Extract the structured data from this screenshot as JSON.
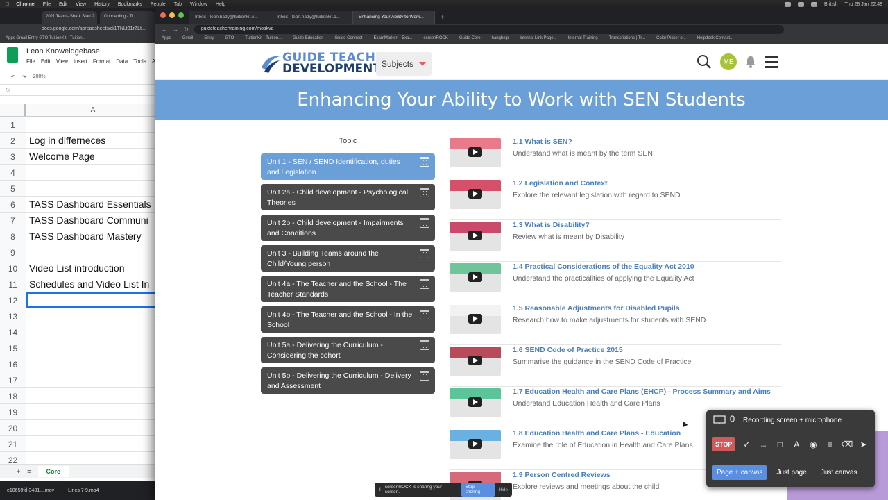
{
  "menubar": {
    "app": "Chrome",
    "items": [
      "File",
      "Edit",
      "View",
      "History",
      "Bookmarks",
      "People",
      "Tab",
      "Window",
      "Help"
    ],
    "input_source": "British",
    "clock": "Thu 28 Jan  22:48"
  },
  "sheets_window": {
    "tabs": [
      "2021 Team - Shark Start 2...",
      "Onboarding - Ti..."
    ],
    "url": "docs.google.com/spreadsheets/d/1TNLt31rZLt...",
    "bookmarks": "Apps   Gmail   Entry   GTO   TuitionKit - Tuition...",
    "title": "Leon Knoweldgebase",
    "menu": [
      "File",
      "Edit",
      "View",
      "Insert",
      "Format",
      "Data",
      "Tools",
      "A"
    ],
    "zoom": "200%",
    "fx": "fx",
    "column": "A",
    "rows": [
      {
        "n": "1",
        "v": ""
      },
      {
        "n": "2",
        "v": "Log in differneces"
      },
      {
        "n": "3",
        "v": "Welcome Page"
      },
      {
        "n": "4",
        "v": ""
      },
      {
        "n": "5",
        "v": ""
      },
      {
        "n": "6",
        "v": "TASS Dashboard Essentials"
      },
      {
        "n": "7",
        "v": "TASS Dashboard Communi"
      },
      {
        "n": "8",
        "v": "TASS Dashboard Mastery"
      },
      {
        "n": "9",
        "v": ""
      },
      {
        "n": "10",
        "v": "Video List introduction"
      },
      {
        "n": "11",
        "v": "Schedules and Video List In"
      },
      {
        "n": "12",
        "v": ""
      },
      {
        "n": "13",
        "v": ""
      },
      {
        "n": "14",
        "v": ""
      },
      {
        "n": "15",
        "v": ""
      },
      {
        "n": "16",
        "v": ""
      },
      {
        "n": "17",
        "v": ""
      },
      {
        "n": "18",
        "v": ""
      },
      {
        "n": "19",
        "v": ""
      },
      {
        "n": "20",
        "v": ""
      },
      {
        "n": "21",
        "v": ""
      },
      {
        "n": "22",
        "v": ""
      }
    ],
    "selected_row": "12",
    "sheet_tab": "Core",
    "downloads": [
      "e10659fd-3481....mov",
      "Lines 7-9.mp4"
    ]
  },
  "browser": {
    "tabs": [
      {
        "label": "Inbox - leon.hady@tuitionkit.c...",
        "active": false
      },
      {
        "label": "Inbox - leon.hady@tuitionkit.c...",
        "active": false
      },
      {
        "label": "Enhancing Your Ability to Work...",
        "active": true
      }
    ],
    "url": "guideteachertraining.com/moskva",
    "bookmarks": [
      "Apps",
      "Gmail",
      "Entry",
      "GTO",
      "TuitionKit - Tuition...",
      "Guide Education",
      "Guide Connect",
      "ExamMarker – Exa...",
      "screenROCK",
      "Guide Core",
      "hanghelp",
      "Internal Link Page...",
      "Internal Training",
      "Transcriptions | Tr...",
      "Color Picker o...",
      "Helpdesk Contact..."
    ]
  },
  "site": {
    "logo_line1": "GUIDE TEACHER",
    "logo_line2": "DEVELOPMENT",
    "subjects_label": "Subjects",
    "avatar_initials": "ME",
    "banner_title": "Enhancing Your Ability to Work with SEN Students",
    "topic_heading": "Topic",
    "units": [
      {
        "label": "Unit 1 - SEN / SEND Identification, duties and Legislation",
        "active": true
      },
      {
        "label": "Unit 2a - Child development - Psychological Theories",
        "active": false
      },
      {
        "label": "Unit 2b - Child development - Impairments and Conditions",
        "active": false
      },
      {
        "label": "Unit 3 - Building Teams around the Child/Young person",
        "active": false
      },
      {
        "label": "Unit 4a - The Teacher and the School - The Teacher Standards",
        "active": false
      },
      {
        "label": "Unit 4b - The Teacher and the School - In the School",
        "active": false
      },
      {
        "label": "Unit 5a - Delivering the Curriculum - Considering the cohort",
        "active": false
      },
      {
        "label": "Unit 5b - Delivering the Curriculum - Delivery and Assessment",
        "active": false
      }
    ],
    "lessons": [
      {
        "title": "1.1 What is SEN?",
        "desc": "Understand what is meant by the term SEN",
        "color": "#e87a8a"
      },
      {
        "title": "1.2 Legislation and Context",
        "desc": "Explore the relevant legislation with regard to SEND",
        "color": "#d6506a"
      },
      {
        "title": "1.3 What is Disability?",
        "desc": "Review what is meant by Disability",
        "color": "#c94a6a"
      },
      {
        "title": "1.4 Practical Considerations of the Equality Act 2010",
        "desc": "Understand the practicalities of applying the Equality Act",
        "color": "#6fc49a"
      },
      {
        "title": "1.5 Reasonable Adjustments for Disabled Pupils",
        "desc": " Research how to make adjustments for students with SEND",
        "color": "#f2f2f2"
      },
      {
        "title": "1.6 SEND Code of Practice 2015",
        "desc": "Summarise the guidance in the SEND Code of Practice",
        "color": "#b84a5a"
      },
      {
        "title": "1.7 Education Health and Care Plans (EHCP) - Process Summary and Aims",
        "desc": "Understand Education Health and Care Plans",
        "color": "#5cc49a"
      },
      {
        "title": "1.8 Education Health and Care Plans - Education",
        "desc": "Examine the role of Education in Health and Care Plans",
        "color": "#6ab0e0"
      },
      {
        "title": "1.9 Person Centred Reviews",
        "desc": "Explore reviews and meetings about the child",
        "color": "#d66a7a"
      }
    ]
  },
  "recorder": {
    "title": "Recording screen + microphone",
    "stop_label": "STOP",
    "modes": [
      {
        "label": "Page + canvas",
        "active": true
      },
      {
        "label": "Just page",
        "active": false
      },
      {
        "label": "Just canvas",
        "active": false
      }
    ]
  },
  "sharing_bar": {
    "text": "screenROCK is sharing your screen.",
    "stop_label": "Stop sharing",
    "hide_label": "Hide"
  }
}
